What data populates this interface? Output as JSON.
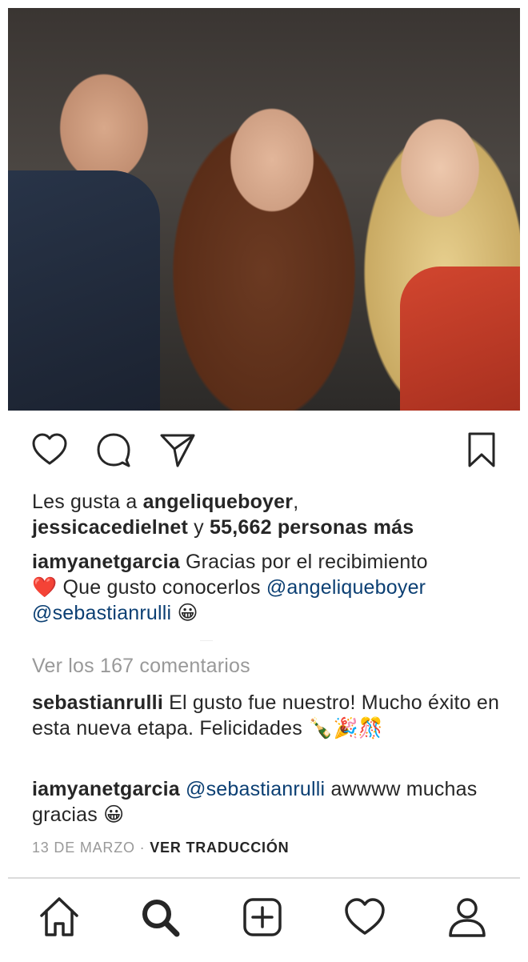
{
  "post": {
    "likes": {
      "prefix": "Les gusta a",
      "user1": "angeliqueboyer",
      "comma": ",",
      "user2": "jessicacedielnet",
      "connector": "y",
      "others": "55,662 personas más"
    },
    "caption": {
      "username": "iamyanetgarcia",
      "text1": "Gracias por el recibimiento",
      "heart": "❤️",
      "text2": "Que gusto conocerlos",
      "mention1": "@angeliqueboyer",
      "mention2": "@sebastianrulli",
      "emoji": "😀"
    },
    "view_comments": "Ver los 167 comentarios",
    "comments": [
      {
        "username": "sebastianrulli",
        "text": "El gusto fue nuestro! Mucho éxito en esta nueva etapa. Felicidades",
        "emoji": "🍾🎉🎊"
      },
      {
        "username": "iamyanetgarcia",
        "mention": "@sebastianrulli",
        "text": "awwww muchas gracias",
        "emoji": "😀"
      }
    ],
    "date": "13 DE MARZO",
    "separator": "·",
    "translate": "VER TRADUCCIÓN"
  },
  "actions": {
    "like_icon": "heart-outline-icon",
    "comment_icon": "speech-bubble-icon",
    "share_icon": "paper-plane-icon",
    "save_icon": "bookmark-icon"
  },
  "tabbar": {
    "tabs": [
      "home-icon",
      "search-icon",
      "new-post-icon",
      "activity-heart-icon",
      "profile-icon"
    ]
  },
  "colors": {
    "text": "#262626",
    "mention": "#0b3f73",
    "muted": "#999999",
    "divider": "#dbdbdb"
  }
}
